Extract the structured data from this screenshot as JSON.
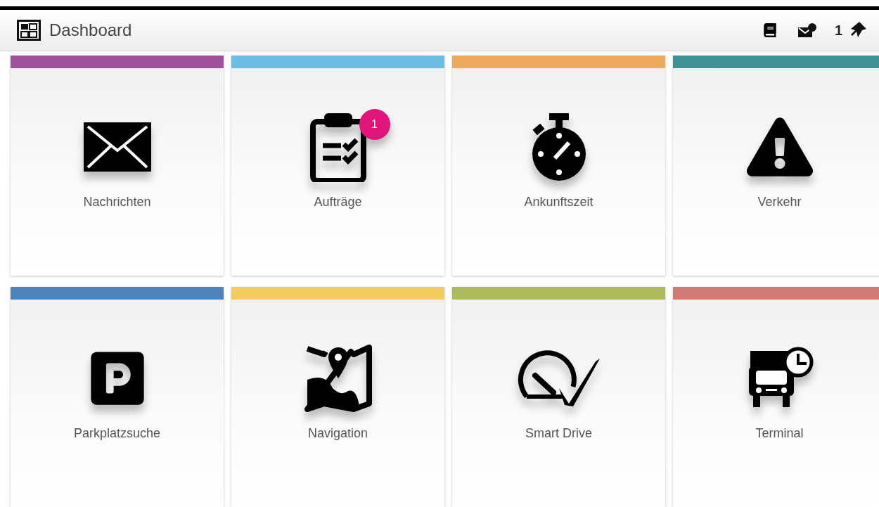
{
  "header": {
    "title": "Dashboard",
    "count": "1"
  },
  "tiles": [
    {
      "label": "Nachrichten",
      "color": "#a0509c",
      "kind": "mail"
    },
    {
      "label": "Aufträge",
      "color": "#6bbde3",
      "kind": "orders",
      "badge": "1"
    },
    {
      "label": "Ankunftszeit",
      "color": "#eeaa5c",
      "kind": "stopwatch"
    },
    {
      "label": "Verkehr",
      "color": "#3f9297",
      "kind": "warning"
    },
    {
      "label": "Parkplatzsuche",
      "color": "#4c84bb",
      "kind": "parking"
    },
    {
      "label": "Navigation",
      "color": "#f2cd5e",
      "kind": "map"
    },
    {
      "label": "Smart Drive",
      "color": "#aebb5a",
      "kind": "speedometer"
    },
    {
      "label": "Terminal",
      "color": "#d07a73",
      "kind": "truck"
    }
  ]
}
